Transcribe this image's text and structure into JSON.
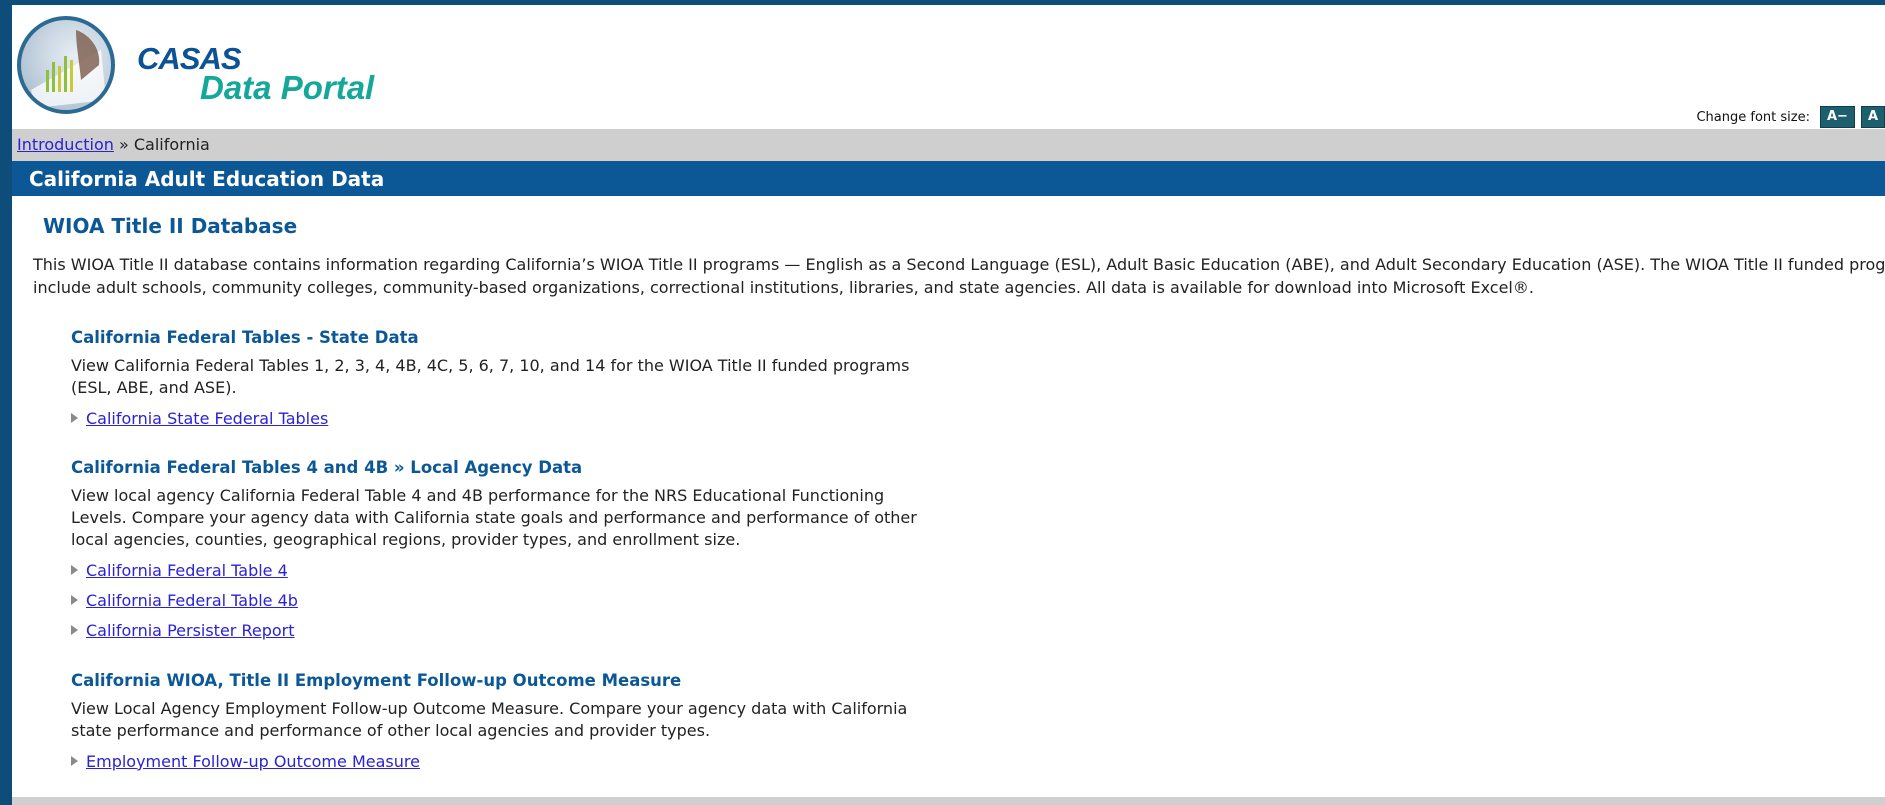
{
  "header": {
    "logo_line1": "CASAS",
    "logo_line2": "Data Portal",
    "font_size_label": "Change font size:",
    "font_decrease": "A−",
    "font_increase": "A"
  },
  "breadcrumb": {
    "home_link": "Introduction",
    "separator": "»",
    "current": "California"
  },
  "titlebar": {
    "title": "California Adult Education Data"
  },
  "main": {
    "heading": "WIOA Title II Database",
    "intro": "This WIOA Title II database contains information regarding California’s WIOA Title II programs — English as a Second Language (ESL), Adult Basic Education (ABE), and Adult Secondary Education (ASE). The WIOA Title II funded programs include adult schools, community colleges, community-based organizations, correctional institutions, libraries, and state agencies. All data is available for download into Microsoft Excel®.",
    "sections": [
      {
        "title": "California Federal Tables - State Data",
        "description": "View California Federal Tables 1, 2, 3, 4, 4B, 4C, 5, 6, 7, 10, and 14 for the WIOA Title II funded programs (ESL, ABE, and ASE).",
        "links": [
          "California State Federal Tables"
        ]
      },
      {
        "title": "California Federal Tables 4 and 4B » Local Agency Data",
        "description": "View local agency California Federal Table 4 and 4B performance for the NRS Educational Functioning Levels. Compare your agency data with California state goals and performance and performance of other local agencies, counties, geographical regions, provider types, and enrollment size.",
        "links": [
          "California Federal Table 4",
          "California Federal Table 4b",
          "California Persister Report"
        ]
      },
      {
        "title": "California WIOA, Title II Employment Follow-up Outcome Measure",
        "description": "View Local Agency Employment Follow-up Outcome Measure. Compare your agency data with California state performance and performance of other local agencies and provider types.",
        "links": [
          " Employment Follow-up Outcome Measure"
        ]
      }
    ]
  },
  "colors": {
    "frame": "#0e4d7a",
    "titlebar": "#0c5896",
    "heading": "#0c5896",
    "breadcrumb_bg": "#cfcfcf",
    "link": "#2a22d6",
    "logo_teal": "#14a89a"
  }
}
